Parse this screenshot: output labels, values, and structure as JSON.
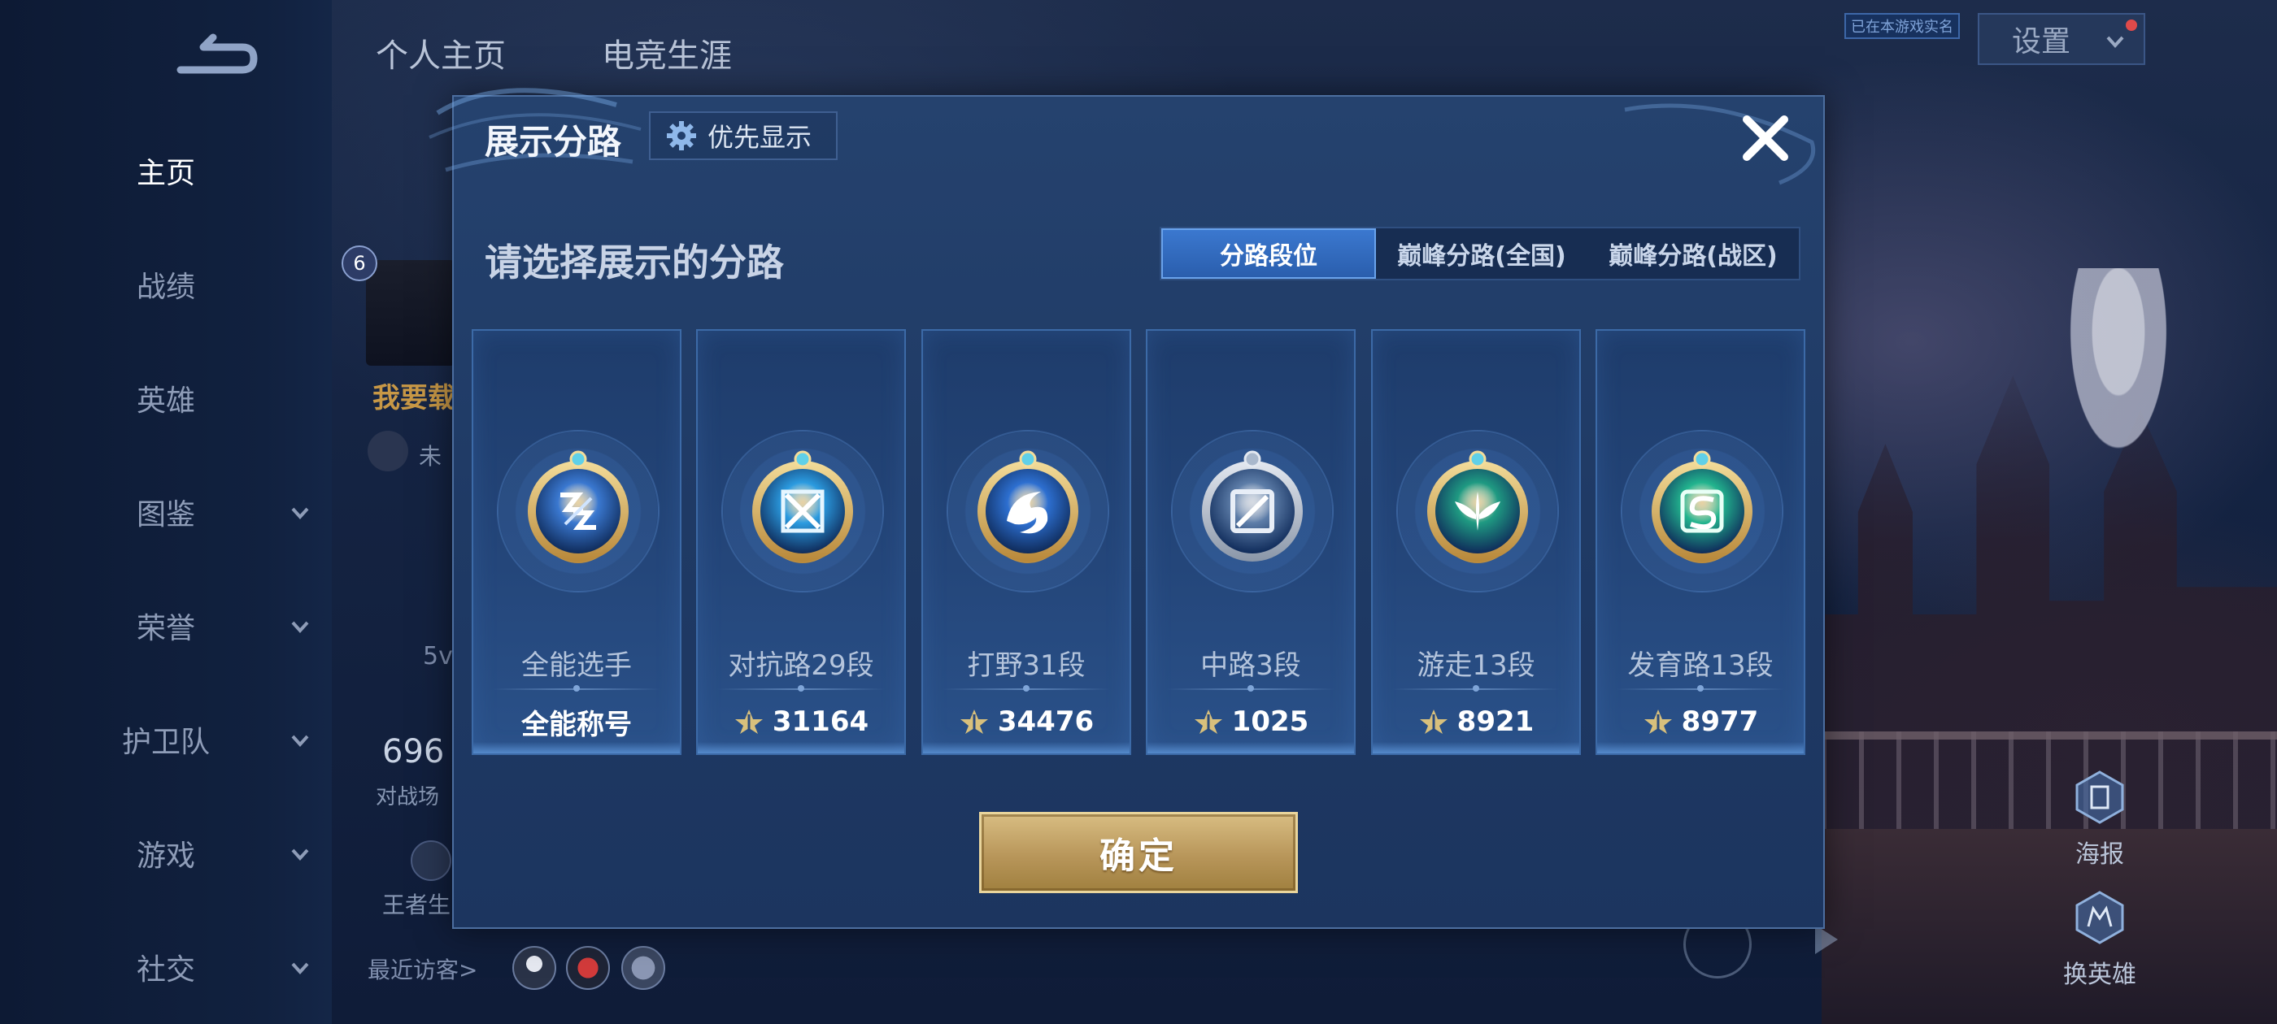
{
  "nav": {
    "items": [
      {
        "label": "主页",
        "active": true,
        "has_chevron": false
      },
      {
        "label": "战绩",
        "active": false,
        "has_chevron": false
      },
      {
        "label": "英雄",
        "active": false,
        "has_chevron": false
      },
      {
        "label": "图鉴",
        "active": false,
        "has_chevron": true
      },
      {
        "label": "荣誉",
        "active": false,
        "has_chevron": true
      },
      {
        "label": "护卫队",
        "active": false,
        "has_chevron": true
      },
      {
        "label": "游戏",
        "active": false,
        "has_chevron": true
      },
      {
        "label": "社交",
        "active": false,
        "has_chevron": true
      }
    ]
  },
  "profile": {
    "tab_personal": "个人主页",
    "tab_career": "电竞生涯",
    "notice": "已在本游戏实名",
    "settings": "设置",
    "level": "6",
    "name": "我要载",
    "status": "未",
    "stat_small": "5v",
    "stat_big": "696",
    "stat_big_label": "对战场",
    "stat_bottom": "王者生",
    "visitors_label": "最近访客>"
  },
  "side": {
    "poster": "海报",
    "change_hero": "换英雄"
  },
  "modal": {
    "title": "展示分路",
    "priority_label": "优先显示",
    "prompt": "请选择展示的分路",
    "tabs": [
      {
        "label": "分路段位",
        "active": true
      },
      {
        "label": "巅峰分路(全国)",
        "active": false
      },
      {
        "label": "巅峰分路(战区)",
        "active": false
      }
    ],
    "cards": [
      {
        "title": "全能选手",
        "value": "全能称号",
        "show_points_icon": false,
        "emblem": "all-rounder",
        "color": "#3a78d0"
      },
      {
        "title": "对抗路29段",
        "value": "31164",
        "show_points_icon": true,
        "emblem": "clash-lane",
        "color": "#2b9be0"
      },
      {
        "title": "打野31段",
        "value": "34476",
        "show_points_icon": true,
        "emblem": "jungle",
        "color": "#2d6fd0"
      },
      {
        "title": "中路3段",
        "value": "1025",
        "show_points_icon": true,
        "emblem": "mid-lane",
        "color": "#5d7da8"
      },
      {
        "title": "游走13段",
        "value": "8921",
        "show_points_icon": true,
        "emblem": "roam",
        "color": "#1f9a82"
      },
      {
        "title": "发育路13段",
        "value": "8977",
        "show_points_icon": true,
        "emblem": "farm-lane",
        "color": "#22b48e"
      }
    ],
    "confirm": "确定"
  },
  "colors": {
    "accent": "#3b78cf",
    "gold": "#c9a867",
    "points": "#d8c07c"
  }
}
